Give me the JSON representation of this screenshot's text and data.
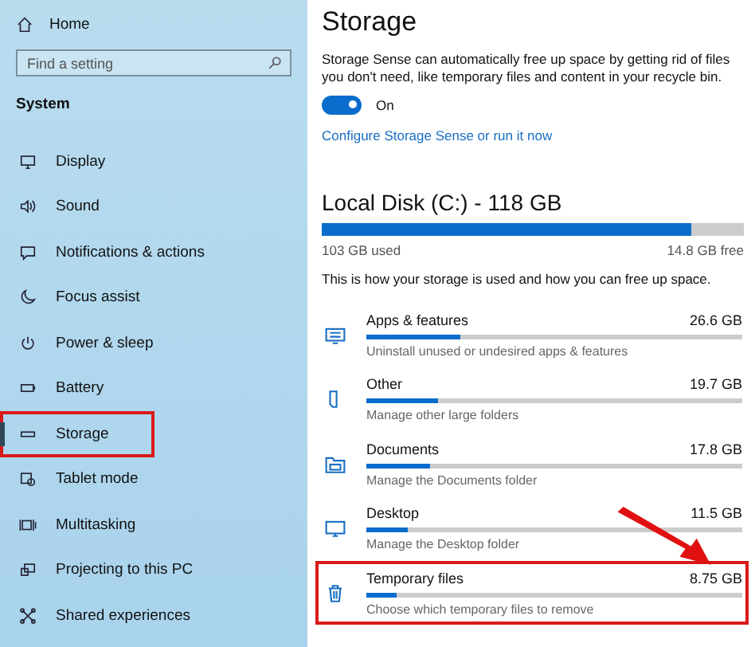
{
  "sidebar": {
    "home": "Home",
    "search": {
      "placeholder": "Find a setting"
    },
    "section": "System",
    "items": [
      {
        "label": "Display",
        "selected": false,
        "highlighted": false
      },
      {
        "label": "Sound",
        "selected": false,
        "highlighted": false
      },
      {
        "label": "Notifications & actions",
        "selected": false,
        "highlighted": false
      },
      {
        "label": "Focus assist",
        "selected": false,
        "highlighted": false
      },
      {
        "label": "Power & sleep",
        "selected": false,
        "highlighted": false
      },
      {
        "label": "Battery",
        "selected": false,
        "highlighted": false
      },
      {
        "label": "Storage",
        "selected": true,
        "highlighted": true
      },
      {
        "label": "Tablet mode",
        "selected": false,
        "highlighted": false
      },
      {
        "label": "Multitasking",
        "selected": false,
        "highlighted": false
      },
      {
        "label": "Projecting to this PC",
        "selected": false,
        "highlighted": false
      },
      {
        "label": "Shared experiences",
        "selected": false,
        "highlighted": false
      }
    ]
  },
  "main": {
    "title": "Storage",
    "description": "Storage Sense can automatically free up space by getting rid of files you don't need, like temporary files and content in your recycle bin.",
    "toggle": {
      "on": true,
      "label": "On"
    },
    "link": "Configure Storage Sense or run it now",
    "disk": {
      "title": "Local Disk (C:) - 118 GB",
      "level": 0.875,
      "used": "103 GB used",
      "free": "14.8 GB free"
    },
    "usage_note": "This is how your storage is used and how you can free up space.",
    "categories": [
      {
        "name": "Apps & features",
        "size": "26.6 GB",
        "level": 0.25,
        "hint": "Uninstall unused or undesired apps & features",
        "highlighted": false
      },
      {
        "name": "Other",
        "size": "19.7 GB",
        "level": 0.19,
        "hint": "Manage other large folders",
        "highlighted": false
      },
      {
        "name": "Documents",
        "size": "17.8 GB",
        "level": 0.17,
        "hint": "Manage the Documents folder",
        "highlighted": false
      },
      {
        "name": "Desktop",
        "size": "11.5 GB",
        "level": 0.11,
        "hint": "Manage the Desktop folder",
        "highlighted": false
      },
      {
        "name": "Temporary files",
        "size": "8.75 GB",
        "level": 0.08,
        "hint": "Choose which temporary files to remove",
        "highlighted": true
      }
    ]
  },
  "annotation": {
    "arrow": true
  }
}
